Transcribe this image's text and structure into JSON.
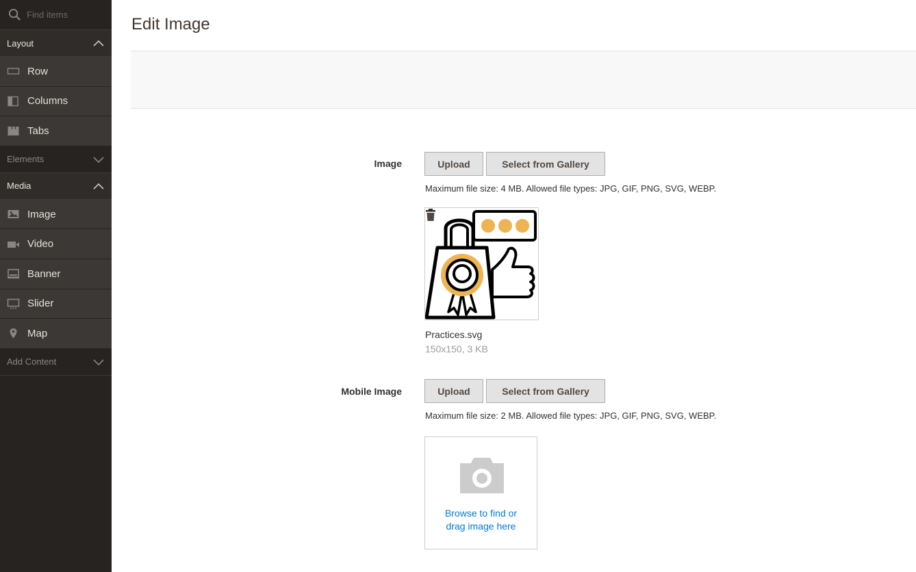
{
  "sidebar": {
    "search_placeholder": "Find items",
    "groups": [
      {
        "label": "Layout",
        "expanded": true,
        "items": [
          {
            "label": "Row",
            "icon": "row-icon"
          },
          {
            "label": "Columns",
            "icon": "columns-icon"
          },
          {
            "label": "Tabs",
            "icon": "tabs-icon"
          }
        ]
      },
      {
        "label": "Elements",
        "expanded": false,
        "items": []
      },
      {
        "label": "Media",
        "expanded": true,
        "items": [
          {
            "label": "Image",
            "icon": "image-icon"
          },
          {
            "label": "Video",
            "icon": "video-icon"
          },
          {
            "label": "Banner",
            "icon": "banner-icon"
          },
          {
            "label": "Slider",
            "icon": "slider-icon"
          },
          {
            "label": "Map",
            "icon": "map-pin-icon"
          }
        ]
      },
      {
        "label": "Add Content",
        "expanded": false,
        "items": []
      }
    ]
  },
  "main": {
    "title": "Edit Image",
    "image_field": {
      "label": "Image",
      "upload_label": "Upload",
      "gallery_label": "Select from Gallery",
      "note": "Maximum file size: 4 MB. Allowed file types: JPG, GIF, PNG, SVG, WEBP.",
      "file_name": "Practices.svg",
      "file_meta": "150x150, 3 KB"
    },
    "mobile_field": {
      "label": "Mobile Image",
      "upload_label": "Upload",
      "gallery_label": "Select from Gallery",
      "note": "Maximum file size: 2 MB. Allowed file types: JPG, GIF, PNG, SVG, WEBP.",
      "dropzone_line1": "Browse to find or",
      "dropzone_line2": "drag image here"
    }
  },
  "colors": {
    "sidebar_bg": "#262320",
    "sidebar_item_bg": "#3b3835",
    "accent_orange": "#eeb352",
    "link_blue": "#007bdb"
  }
}
